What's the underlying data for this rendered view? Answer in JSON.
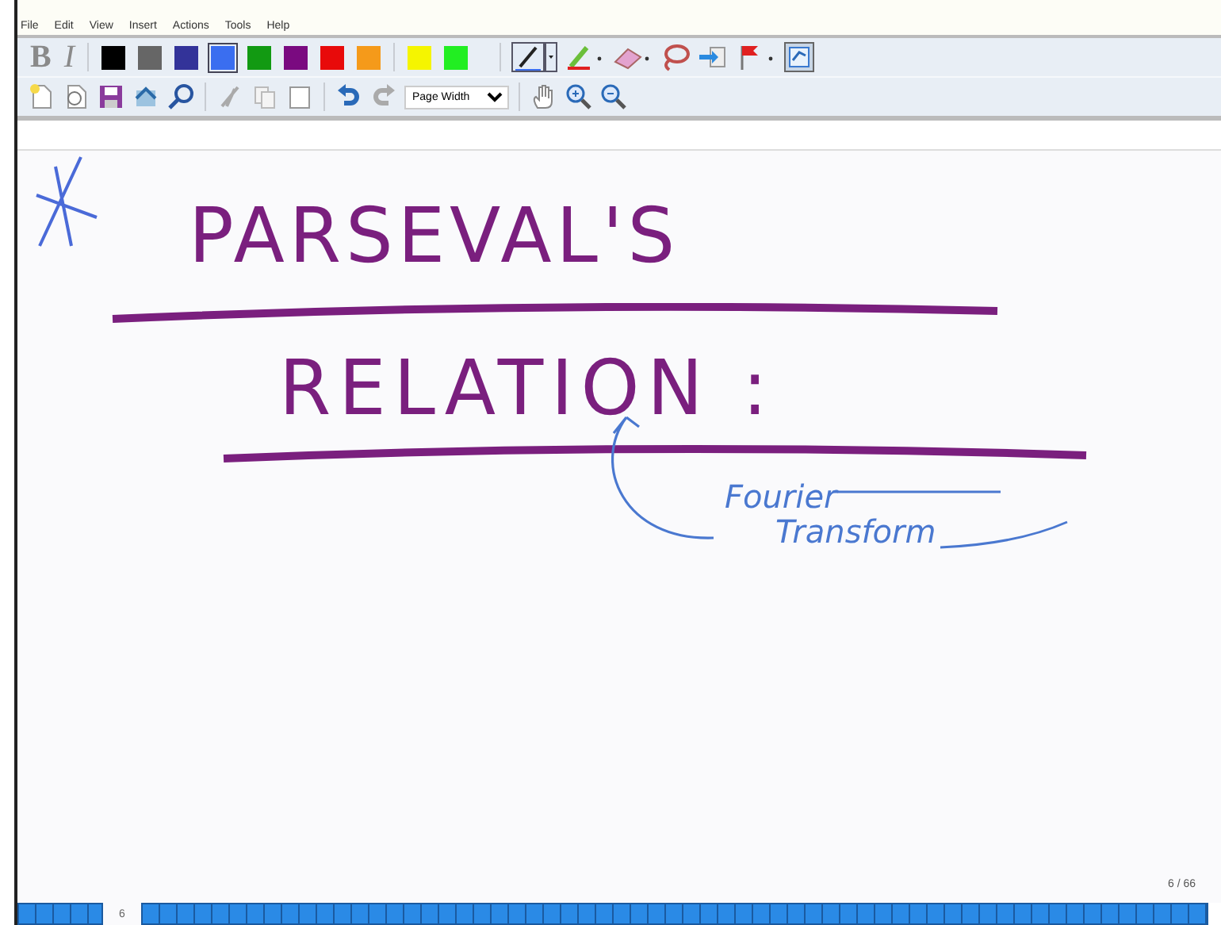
{
  "menu": [
    "File",
    "Edit",
    "View",
    "Insert",
    "Actions",
    "Tools",
    "Help"
  ],
  "format_buttons": [
    {
      "label": "B",
      "disabled": true
    },
    {
      "label": "I",
      "disabled": true
    }
  ],
  "pen_colors": [
    {
      "color": "#000000",
      "selected": false
    },
    {
      "color": "#666666",
      "selected": false
    },
    {
      "color": "#333399",
      "selected": false
    },
    {
      "color": "#3a6ef0",
      "selected": true
    },
    {
      "color": "#129a12",
      "selected": false
    },
    {
      "color": "#7a0a80",
      "selected": false
    },
    {
      "color": "#e80a0a",
      "selected": false
    },
    {
      "color": "#f59a1a",
      "selected": false
    },
    {
      "color": "#f5f500",
      "selected": false
    },
    {
      "color": "#22ee22",
      "selected": false
    }
  ],
  "zoom_select": {
    "value": "Page Width"
  },
  "ink": [
    {
      "kind": "heading",
      "text": "PARSEVAL'S",
      "color": "#7a1f7e"
    },
    {
      "kind": "heading",
      "text": "RELATION :",
      "color": "#7a1f7e"
    },
    {
      "kind": "note",
      "text": "Fourier",
      "color": "#4a78d0"
    },
    {
      "kind": "note",
      "text": "Transform",
      "color": "#4a78d0"
    }
  ],
  "page_counter": "6 / 66",
  "page_strip": {
    "current": "6"
  }
}
